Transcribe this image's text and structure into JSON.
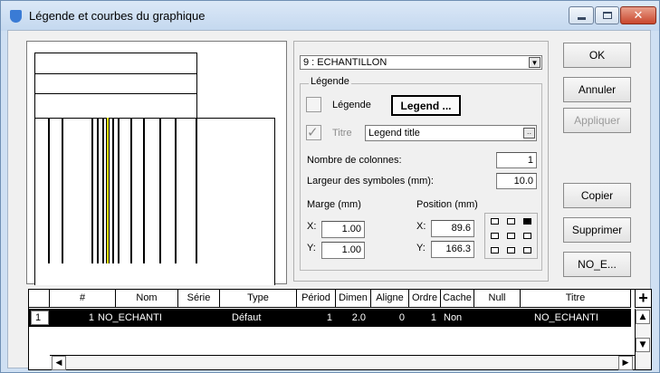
{
  "window": {
    "title": "Légende et courbes du graphique",
    "close_glyph": "✕"
  },
  "curve_select": {
    "value": "9 : ECHANTILLON",
    "arrow": "▼"
  },
  "legend_group": {
    "title": "Légende",
    "legend_label": "Légende",
    "legend_button": "Legend ...",
    "title_label": "Titre",
    "title_value": "Legend title",
    "title_checked": true,
    "legend_checked": false,
    "columns_label": "Nombre de colonnes:",
    "columns_value": "1",
    "symbol_width_label": "Largeur des symboles (mm):",
    "symbol_width_value": "10.0",
    "margin_label": "Marge (mm)",
    "margin_x_label": "X:",
    "margin_x": "1.00",
    "margin_y_label": "Y:",
    "margin_y": "1.00",
    "position_label": "Position (mm)",
    "position_x_label": "X:",
    "position_x": "89.6",
    "position_y_label": "Y:",
    "position_y": "166.3",
    "anchor_selected": "top-right"
  },
  "buttons": {
    "ok": "OK",
    "cancel": "Annuler",
    "apply": "Appliquer",
    "copy": "Copier",
    "delete": "Supprimer",
    "no_e": "NO_E..."
  },
  "table": {
    "add_glyph": "+",
    "columns": [
      "#",
      "Nom",
      "Série",
      "Type",
      "Périod",
      "Dimen",
      "Aligne",
      "Ordre",
      "Cache",
      "Null",
      "Titre"
    ],
    "rows": [
      {
        "row_number": "1",
        "num": "1",
        "nom": "NO_ECHANTI",
        "serie": "",
        "type": "Défaut",
        "periode": "1",
        "dimension": "2.0",
        "alignement": "0",
        "ordre": "1",
        "cache": "Non",
        "null": "",
        "titre": "NO_ECHANTI"
      }
    ]
  }
}
